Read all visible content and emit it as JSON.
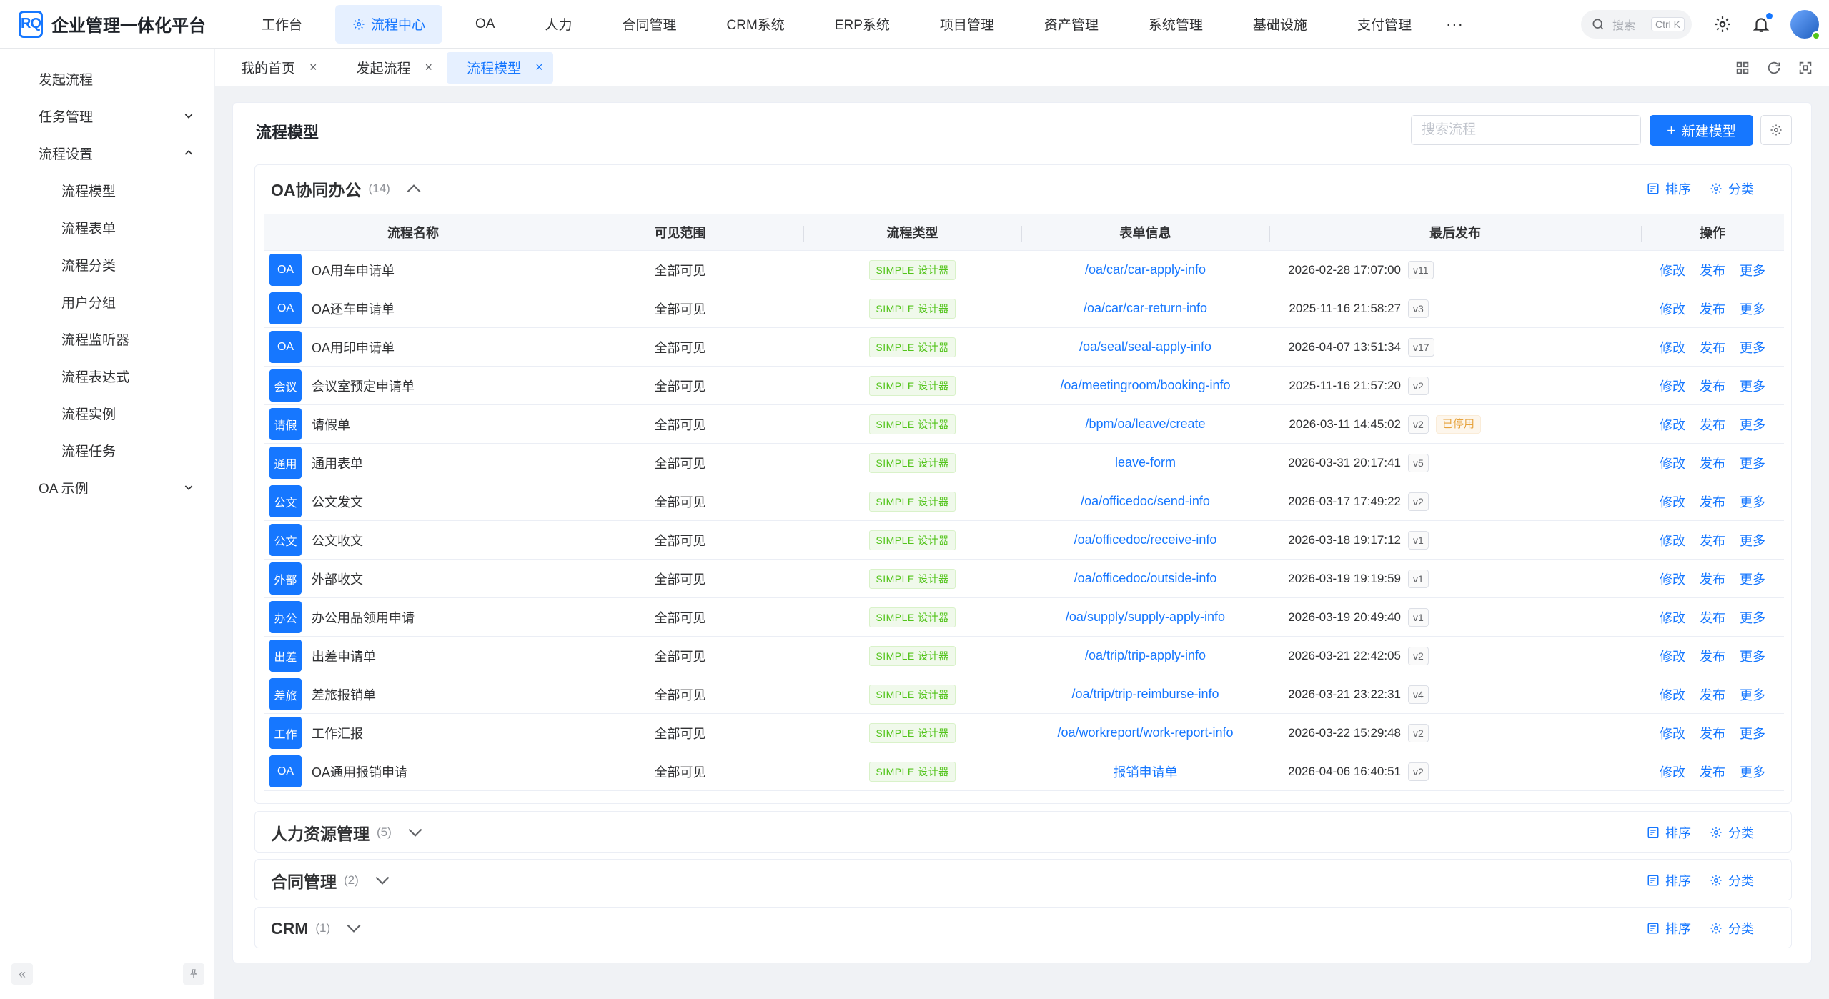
{
  "header": {
    "logo_text": "RQ",
    "title": "企业管理一体化平台",
    "nav": [
      {
        "label": "工作台",
        "active": false
      },
      {
        "label": "流程中心",
        "active": true
      },
      {
        "label": "OA",
        "active": false
      },
      {
        "label": "人力",
        "active": false
      },
      {
        "label": "合同管理",
        "active": false
      },
      {
        "label": "CRM系统",
        "active": false
      },
      {
        "label": "ERP系统",
        "active": false
      },
      {
        "label": "项目管理",
        "active": false
      },
      {
        "label": "资产管理",
        "active": false
      },
      {
        "label": "系统管理",
        "active": false
      },
      {
        "label": "基础设施",
        "active": false
      },
      {
        "label": "支付管理",
        "active": false
      }
    ],
    "more": "···",
    "search_placeholder": "搜索",
    "search_shortcut": "Ctrl K"
  },
  "sidebar": {
    "items": [
      {
        "label": "发起流程",
        "level": 1,
        "chevron": "none"
      },
      {
        "label": "任务管理",
        "level": 1,
        "chevron": "down"
      },
      {
        "label": "流程设置",
        "level": 1,
        "chevron": "up"
      },
      {
        "label": "流程模型",
        "level": 2,
        "chevron": "none"
      },
      {
        "label": "流程表单",
        "level": 2,
        "chevron": "none"
      },
      {
        "label": "流程分类",
        "level": 2,
        "chevron": "none"
      },
      {
        "label": "用户分组",
        "level": 2,
        "chevron": "none"
      },
      {
        "label": "流程监听器",
        "level": 2,
        "chevron": "none"
      },
      {
        "label": "流程表达式",
        "level": 2,
        "chevron": "none"
      },
      {
        "label": "流程实例",
        "level": 2,
        "chevron": "none"
      },
      {
        "label": "流程任务",
        "level": 2,
        "chevron": "none"
      },
      {
        "label": "OA 示例",
        "level": 1,
        "chevron": "down"
      }
    ],
    "collapse_glyph": "«"
  },
  "tabs": [
    {
      "label": "我的首页",
      "active": false
    },
    {
      "label": "发起流程",
      "active": false
    },
    {
      "label": "流程模型",
      "active": true
    }
  ],
  "page": {
    "title": "流程模型",
    "search_placeholder": "搜索流程",
    "new_button": "新建模型",
    "sort_label": "排序",
    "category_label": "分类"
  },
  "columns": [
    "流程名称",
    "可见范围",
    "流程类型",
    "表单信息",
    "最后发布",
    "操作"
  ],
  "row_actions": {
    "edit": "修改",
    "publish": "发布",
    "more": "更多"
  },
  "groups": [
    {
      "name": "OA协同办公",
      "count": "(14)",
      "expanded": true,
      "rows": [
        {
          "icon": "OA",
          "name": "OA用车申请单",
          "scope": "全部可见",
          "type": "SIMPLE 设计器",
          "form": "/oa/car/car-apply-info",
          "published": "2026-02-28 17:07:00",
          "version": "v11",
          "status": ""
        },
        {
          "icon": "OA",
          "name": "OA还车申请单",
          "scope": "全部可见",
          "type": "SIMPLE 设计器",
          "form": "/oa/car/car-return-info",
          "published": "2025-11-16 21:58:27",
          "version": "v3",
          "status": ""
        },
        {
          "icon": "OA",
          "name": "OA用印申请单",
          "scope": "全部可见",
          "type": "SIMPLE 设计器",
          "form": "/oa/seal/seal-apply-info",
          "published": "2026-04-07 13:51:34",
          "version": "v17",
          "status": ""
        },
        {
          "icon": "会议",
          "name": "会议室预定申请单",
          "scope": "全部可见",
          "type": "SIMPLE 设计器",
          "form": "/oa/meetingroom/booking-info",
          "published": "2025-11-16 21:57:20",
          "version": "v2",
          "status": ""
        },
        {
          "icon": "请假",
          "name": "请假单",
          "scope": "全部可见",
          "type": "SIMPLE 设计器",
          "form": "/bpm/oa/leave/create",
          "published": "2026-03-11 14:45:02",
          "version": "v2",
          "status": "已停用"
        },
        {
          "icon": "通用",
          "name": "通用表单",
          "scope": "全部可见",
          "type": "SIMPLE 设计器",
          "form": "leave-form",
          "published": "2026-03-31 20:17:41",
          "version": "v5",
          "status": ""
        },
        {
          "icon": "公文",
          "name": "公文发文",
          "scope": "全部可见",
          "type": "SIMPLE 设计器",
          "form": "/oa/officedoc/send-info",
          "published": "2026-03-17 17:49:22",
          "version": "v2",
          "status": ""
        },
        {
          "icon": "公文",
          "name": "公文收文",
          "scope": "全部可见",
          "type": "SIMPLE 设计器",
          "form": "/oa/officedoc/receive-info",
          "published": "2026-03-18 19:17:12",
          "version": "v1",
          "status": ""
        },
        {
          "icon": "外部",
          "name": "外部收文",
          "scope": "全部可见",
          "type": "SIMPLE 设计器",
          "form": "/oa/officedoc/outside-info",
          "published": "2026-03-19 19:19:59",
          "version": "v1",
          "status": ""
        },
        {
          "icon": "办公",
          "name": "办公用品领用申请",
          "scope": "全部可见",
          "type": "SIMPLE 设计器",
          "form": "/oa/supply/supply-apply-info",
          "published": "2026-03-19 20:49:40",
          "version": "v1",
          "status": ""
        },
        {
          "icon": "出差",
          "name": "出差申请单",
          "scope": "全部可见",
          "type": "SIMPLE 设计器",
          "form": "/oa/trip/trip-apply-info",
          "published": "2026-03-21 22:42:05",
          "version": "v2",
          "status": ""
        },
        {
          "icon": "差旅",
          "name": "差旅报销单",
          "scope": "全部可见",
          "type": "SIMPLE 设计器",
          "form": "/oa/trip/trip-reimburse-info",
          "published": "2026-03-21 23:22:31",
          "version": "v4",
          "status": ""
        },
        {
          "icon": "工作",
          "name": "工作汇报",
          "scope": "全部可见",
          "type": "SIMPLE 设计器",
          "form": "/oa/workreport/work-report-info",
          "published": "2026-03-22 15:29:48",
          "version": "v2",
          "status": ""
        },
        {
          "icon": "OA",
          "name": "OA通用报销申请",
          "scope": "全部可见",
          "type": "SIMPLE 设计器",
          "form": "报销申请单",
          "published": "2026-04-06 16:40:51",
          "version": "v2",
          "status": ""
        }
      ]
    },
    {
      "name": "人力资源管理",
      "count": "(5)",
      "expanded": false,
      "rows": []
    },
    {
      "name": "合同管理",
      "count": "(2)",
      "expanded": false,
      "rows": []
    },
    {
      "name": "CRM",
      "count": "(1)",
      "expanded": false,
      "rows": []
    }
  ],
  "colors": {
    "accent": "#1677ff",
    "simple_tag": "#52c41a",
    "stopped": "#e6a23c"
  }
}
